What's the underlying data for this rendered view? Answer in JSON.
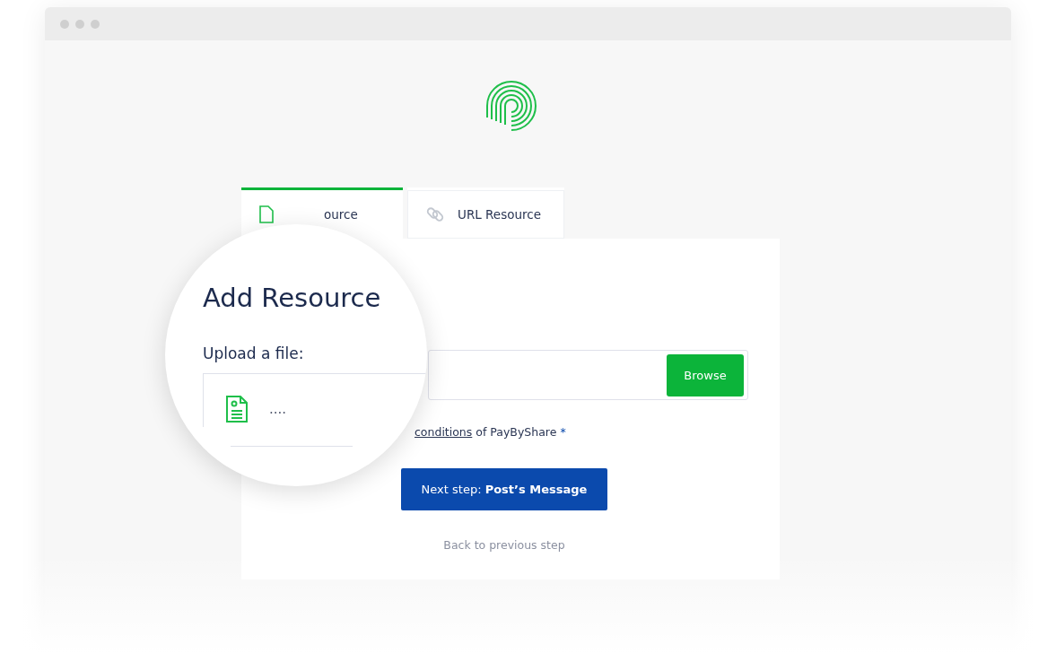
{
  "tabs": [
    {
      "label": "ource",
      "selected": true,
      "kind": "file"
    },
    {
      "label": "URL Resource",
      "selected": false,
      "kind": "url"
    }
  ],
  "form": {
    "file_field": {
      "button": "Browse"
    },
    "terms": {
      "link": "conditions",
      "text": "of PayByShare",
      "required_mark": "*"
    },
    "next_button": "Next step: **Post’s Message**",
    "back_link": "Back to previous step"
  },
  "magnifier": {
    "title": "Add Resource",
    "label": "Upload a file:",
    "file_name": "...."
  }
}
